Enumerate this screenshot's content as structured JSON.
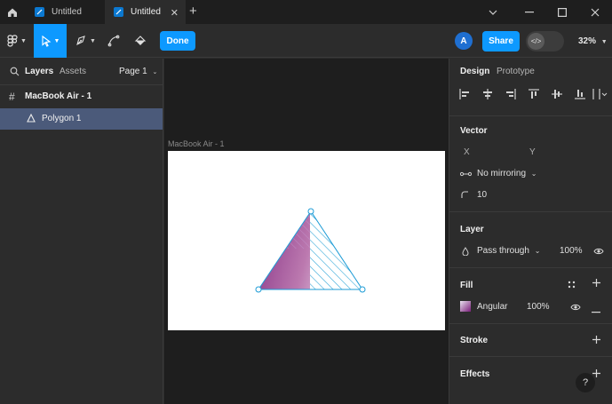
{
  "tabs": [
    {
      "label": "Untitled",
      "active": false
    },
    {
      "label": "Untitled",
      "active": true
    }
  ],
  "icons": {
    "home": "home-icon",
    "close": "close-icon",
    "add": "plus-icon",
    "minimize": "minimize-icon",
    "maximize": "maximize-icon",
    "chevron": "chevron-down-icon"
  },
  "toolbar": {
    "done_label": "Done",
    "avatar_initial": "A",
    "share_label": "Share",
    "zoom": "32%",
    "dev_mode_glyph": "</>"
  },
  "layers_panel": {
    "tab_layers": "Layers",
    "tab_assets": "Assets",
    "page": "Page 1",
    "frame_name": "MacBook Air - 1",
    "selected_layer": "Polygon 1"
  },
  "canvas": {
    "frame_label": "MacBook Air - 1",
    "fill_colors": {
      "gradient_start": "#7b1e7a",
      "gradient_end": "#e9e2f0",
      "hatch": "#35a8d8",
      "handle": "#1c9bd6"
    }
  },
  "design_panel": {
    "tab_design": "Design",
    "tab_prototype": "Prototype",
    "vector": {
      "title": "Vector",
      "x_label": "X",
      "y_label": "Y",
      "mirroring": "No mirroring",
      "corner_radius": "10"
    },
    "layer": {
      "title": "Layer",
      "blend": "Pass through",
      "opacity": "100%"
    },
    "fill": {
      "title": "Fill",
      "type": "Angular",
      "opacity": "100%"
    },
    "stroke": {
      "title": "Stroke"
    },
    "effects": {
      "title": "Effects"
    }
  },
  "help_label": "?"
}
